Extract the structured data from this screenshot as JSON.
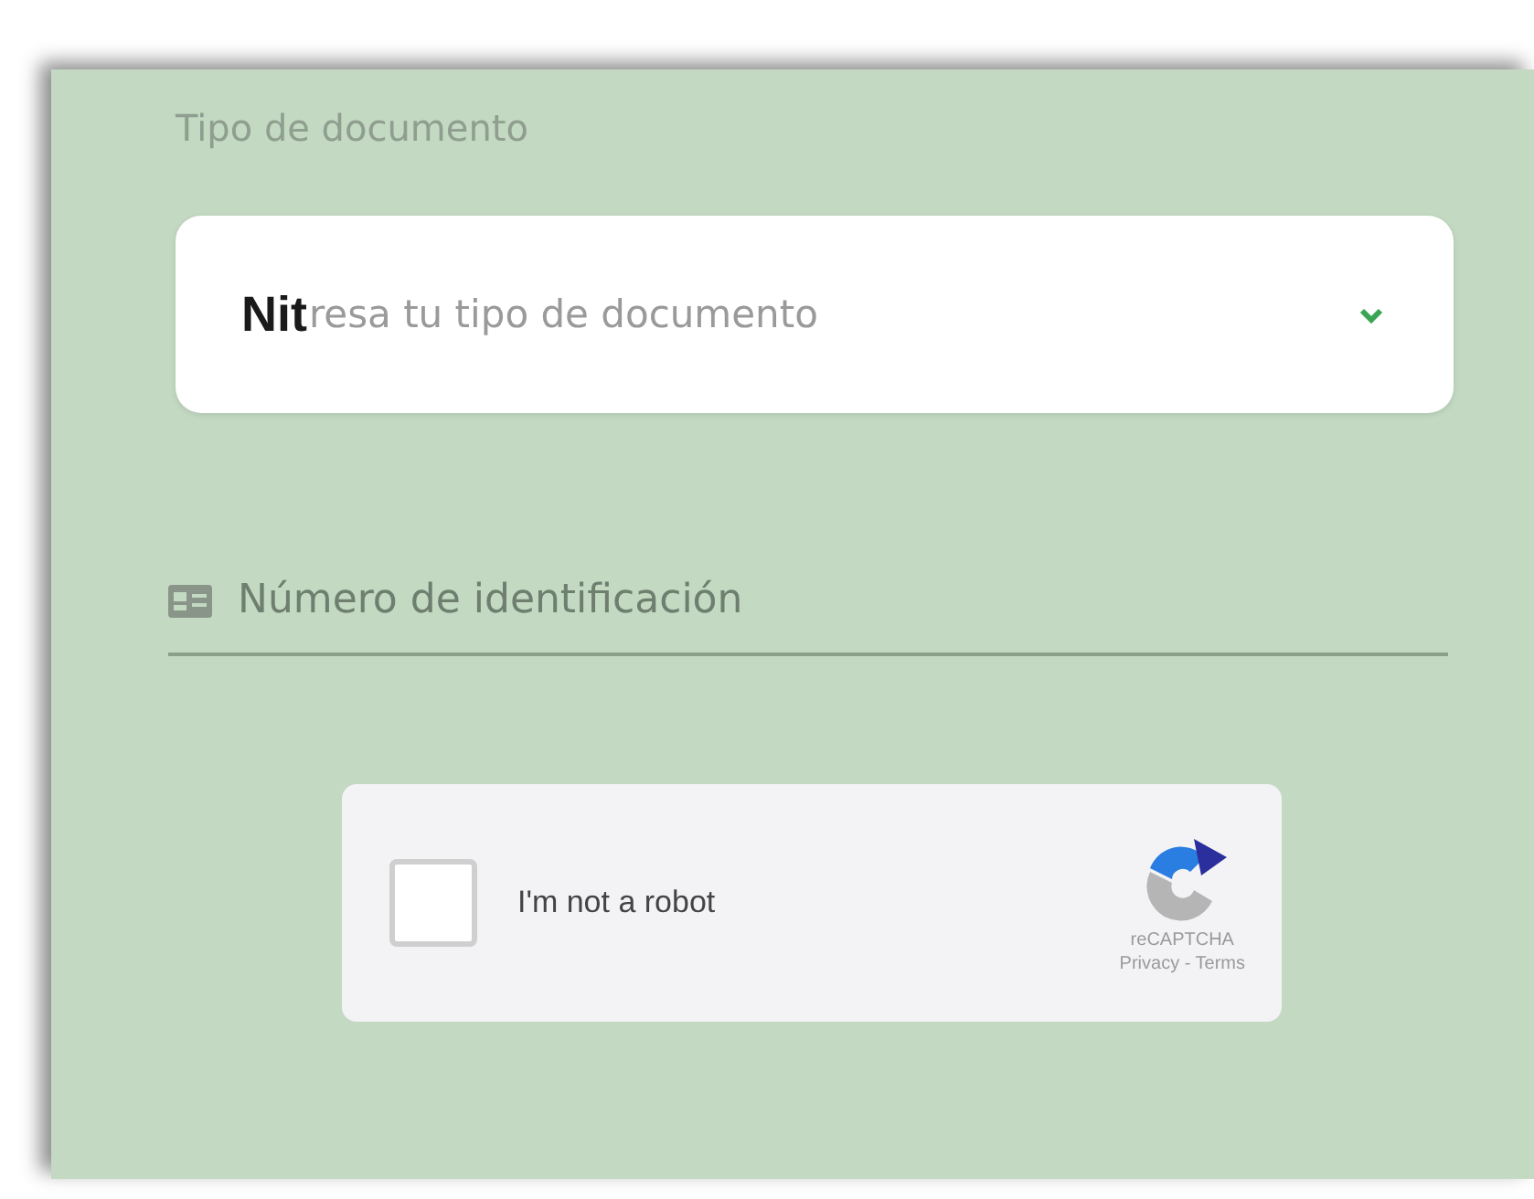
{
  "document_type": {
    "label": "Tipo de documento",
    "value": "Nit",
    "placeholder": "resa tu tipo de documento"
  },
  "id_number": {
    "placeholder": "Número de identificación"
  },
  "recaptcha": {
    "label": "I'm not a robot",
    "checked": false,
    "brand": "reCAPTCHA",
    "links": "Privacy - Terms"
  }
}
